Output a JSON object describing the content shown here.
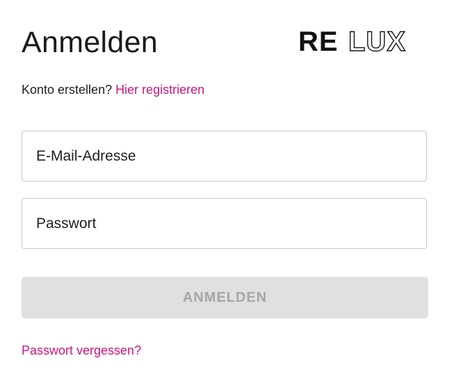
{
  "header": {
    "title": "Anmelden",
    "logo_text": "RELUX"
  },
  "register": {
    "prompt": "Konto erstellen?",
    "link_label": "Hier registrieren"
  },
  "form": {
    "email_placeholder": "E-Mail-Adresse",
    "email_value": "",
    "password_placeholder": "Passwort",
    "password_value": "",
    "submit_label": "ANMELDEN",
    "submit_state": "disabled"
  },
  "links": {
    "forgot_password": "Passwort vergessen?"
  },
  "colors": {
    "accent": "#d0147f",
    "text": "#1f1f1f",
    "button_disabled_bg": "#e0e0e0",
    "button_disabled_text": "#a6a6a6",
    "border": "#c9c9c9"
  }
}
